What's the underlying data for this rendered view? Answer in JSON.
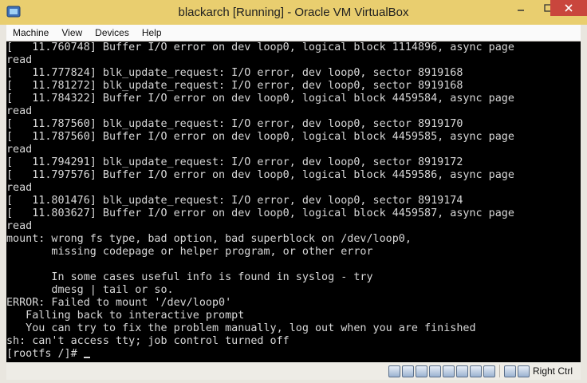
{
  "window": {
    "title": "blackarch [Running] - Oracle VM VirtualBox"
  },
  "menu": {
    "items": [
      {
        "label": "Machine"
      },
      {
        "label": "View"
      },
      {
        "label": "Devices"
      },
      {
        "label": "Help"
      }
    ]
  },
  "console": {
    "lines": [
      "[   11.760748] Buffer I/O error on dev loop0, logical block 1114896, async page",
      "read",
      "[   11.777824] blk_update_request: I/O error, dev loop0, sector 8919168",
      "[   11.781272] blk_update_request: I/O error, dev loop0, sector 8919168",
      "[   11.784322] Buffer I/O error on dev loop0, logical block 4459584, async page",
      "read",
      "[   11.787560] blk_update_request: I/O error, dev loop0, sector 8919170",
      "[   11.787560] Buffer I/O error on dev loop0, logical block 4459585, async page",
      "read",
      "[   11.794291] blk_update_request: I/O error, dev loop0, sector 8919172",
      "[   11.797576] Buffer I/O error on dev loop0, logical block 4459586, async page",
      "read",
      "[   11.801476] blk_update_request: I/O error, dev loop0, sector 8919174",
      "[   11.803627] Buffer I/O error on dev loop0, logical block 4459587, async page",
      "read",
      "mount: wrong fs type, bad option, bad superblock on /dev/loop0,",
      "       missing codepage or helper program, or other error",
      "",
      "       In some cases useful info is found in syslog - try",
      "       dmesg | tail or so.",
      "ERROR: Failed to mount '/dev/loop0'",
      "   Falling back to interactive prompt",
      "   You can try to fix the problem manually, log out when you are finished",
      "sh: can't access tty; job control turned off"
    ],
    "prompt": "[rootfs /]# "
  },
  "statusbar": {
    "icons": [
      "hard-disk-icon",
      "optical-drive-icon",
      "usb-icon",
      "network-icon",
      "shared-folders-icon",
      "display-icon",
      "video-capture-icon",
      "cpu-icon",
      "mouse-integration-icon",
      "keyboard-icon"
    ],
    "host_key": "Right Ctrl"
  }
}
